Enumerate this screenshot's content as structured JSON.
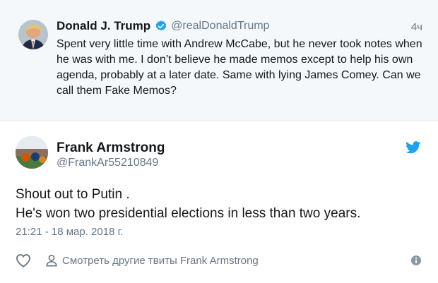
{
  "quoted_tweet": {
    "author_name": "Donald J. Trump",
    "author_handle": "@realDonaldTrump",
    "time": "4ч",
    "text": "Spent very little time with Andrew McCabe, but he never took notes when he was with me. I don’t believe he made memos except to help his own agenda, probably at a later date. Same with lying James Comey. Can we call them Fake Memos?",
    "verified_color": "#1da1f2",
    "avatar_icon": "profile-photo"
  },
  "tweet": {
    "author_name": "Frank Armstrong",
    "author_handle": "@FrankAr55210849",
    "text_line1": "Shout out to Putin .",
    "text_line2": "He's won two presidential elections in less than two years.",
    "timestamp": "21:21 - 18 мар. 2018 г.",
    "more_tweets_label": "Смотреть другие твиты Frank Armstrong",
    "brand_color": "#1da1f2"
  }
}
